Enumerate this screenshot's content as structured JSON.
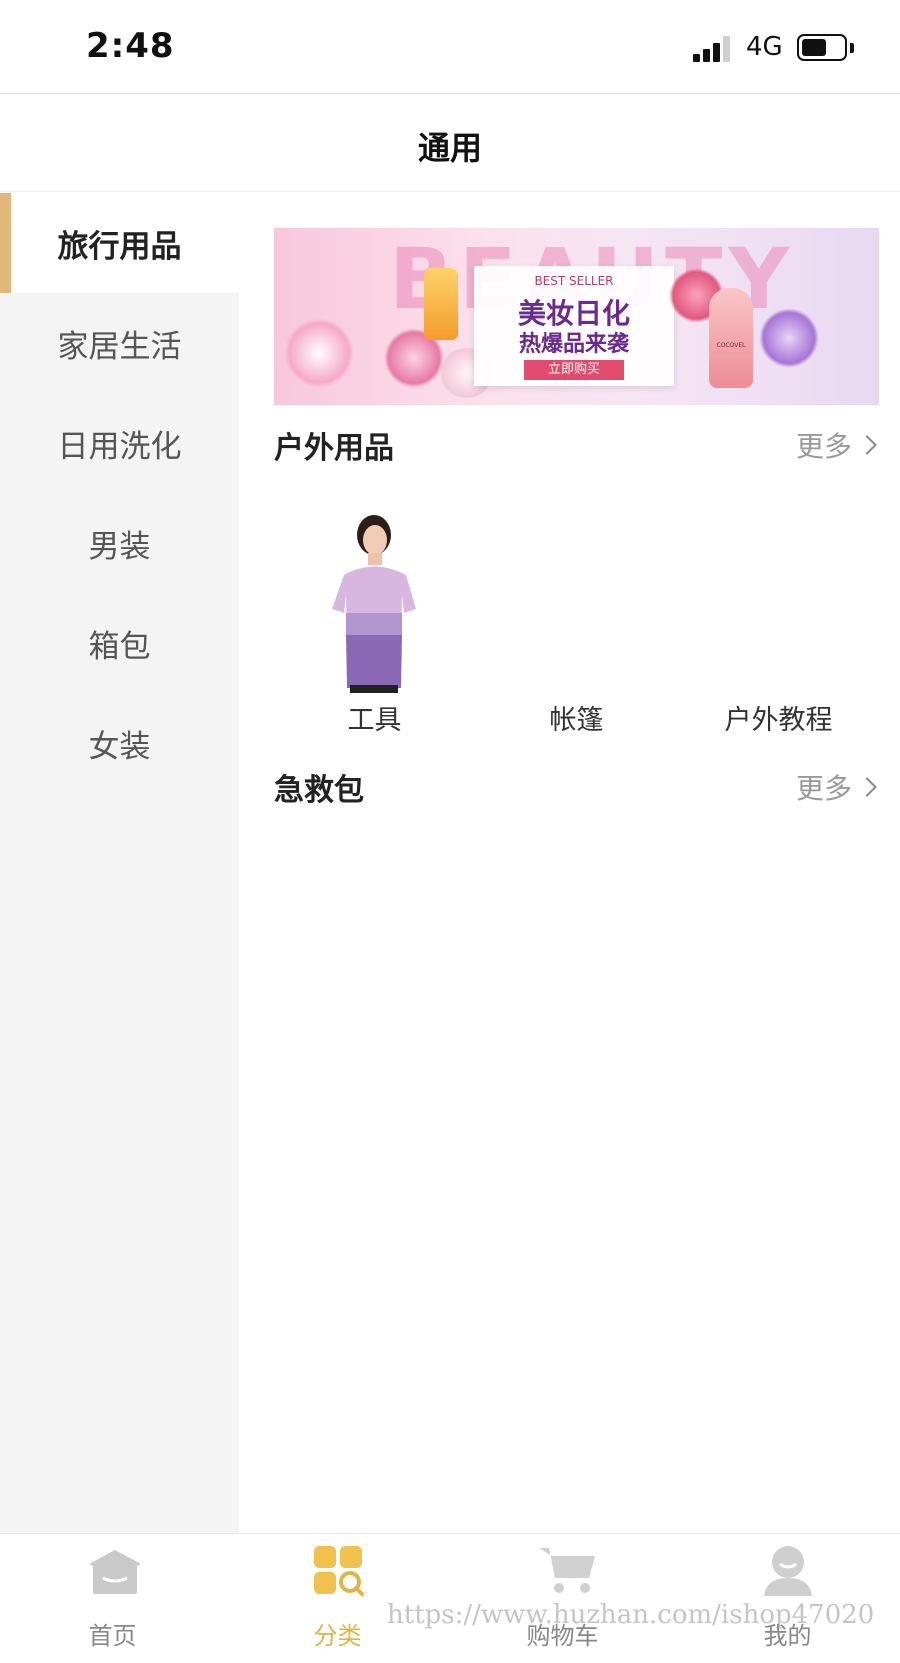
{
  "status_bar": {
    "time": "2:48",
    "network": "4G"
  },
  "header": {
    "title": "通用"
  },
  "sidebar": {
    "items": [
      {
        "label": "旅行用品",
        "active": true
      },
      {
        "label": "家居生活",
        "active": false
      },
      {
        "label": "日用洗化",
        "active": false
      },
      {
        "label": "男装",
        "active": false
      },
      {
        "label": "箱包",
        "active": false
      },
      {
        "label": "女装",
        "active": false
      }
    ]
  },
  "banner": {
    "bg_word": "BEAUTY",
    "small": "BEST SELLER",
    "line1": "美妆日化",
    "line2": "热爆品来袭",
    "button": "立即购买",
    "product_label": "COCOVEL"
  },
  "sections": [
    {
      "title": "户外用品",
      "more": "更多",
      "items": [
        {
          "label": "工具",
          "image": "woman-tshirt-photo"
        },
        {
          "label": "帐篷"
        },
        {
          "label": "户外教程"
        }
      ]
    },
    {
      "title": "急救包",
      "more": "更多"
    }
  ],
  "tabbar": {
    "tabs": [
      {
        "label": "首页",
        "icon": "home-icon",
        "active": false
      },
      {
        "label": "分类",
        "icon": "category-icon",
        "active": true
      },
      {
        "label": "购物车",
        "icon": "cart-icon",
        "active": false
      },
      {
        "label": "我的",
        "icon": "profile-icon",
        "active": false
      }
    ]
  },
  "watermark": "https://www.huzhan.com/ishop47020",
  "colors": {
    "accent": "#e2b87a",
    "tab_active": "#e2b340",
    "sidebar_bg": "#f4f4f4"
  }
}
